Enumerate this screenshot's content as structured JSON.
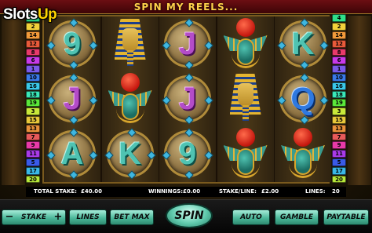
{
  "banner": {
    "text": "SPIN MY REELS..."
  },
  "watermark": {
    "brand": "Slots",
    "brand_accent": "Up"
  },
  "line_numbers": {
    "left": [
      "4",
      "2",
      "14",
      "12",
      "8",
      "6",
      "1",
      "10",
      "16",
      "18",
      "19",
      "3",
      "15",
      "13",
      "7",
      "9",
      "11",
      "5",
      "17",
      "20"
    ],
    "right": [
      "4",
      "2",
      "14",
      "12",
      "8",
      "6",
      "1",
      "10",
      "16",
      "18",
      "19",
      "3",
      "15",
      "13",
      "7",
      "9",
      "11",
      "5",
      "17",
      "20"
    ]
  },
  "line_colors": [
    "#2fe08a",
    "#f2d13a",
    "#f29a3a",
    "#e85a3a",
    "#e83a6a",
    "#c83ae8",
    "#7a5ae8",
    "#3a7ae8",
    "#3ac8e8",
    "#3ae8b8",
    "#5ae83a",
    "#c8e83a",
    "#e8c83a",
    "#e8903a",
    "#e85a5a",
    "#e83aa8",
    "#a83ae8",
    "#3a5ae8",
    "#3ab8e8",
    "#b8e83a"
  ],
  "reels": [
    {
      "symbols": [
        {
          "type": "tile",
          "glyph": "9",
          "color": "teal"
        },
        {
          "type": "tile",
          "glyph": "J",
          "color": "purple"
        },
        {
          "type": "tile",
          "glyph": "A",
          "color": "teal"
        }
      ]
    },
    {
      "symbols": [
        {
          "type": "pharaoh",
          "name": "pharaoh-mask"
        },
        {
          "type": "scarab",
          "name": "scarab"
        },
        {
          "type": "tile",
          "glyph": "K",
          "color": "teal"
        }
      ]
    },
    {
      "symbols": [
        {
          "type": "tile",
          "glyph": "J",
          "color": "purple"
        },
        {
          "type": "tile",
          "glyph": "J",
          "color": "purple"
        },
        {
          "type": "tile",
          "glyph": "9",
          "color": "teal"
        }
      ]
    },
    {
      "symbols": [
        {
          "type": "scarab",
          "name": "scarab"
        },
        {
          "type": "pharaoh",
          "name": "pharaoh-mask"
        },
        {
          "type": "scarab",
          "name": "scarab"
        }
      ]
    },
    {
      "symbols": [
        {
          "type": "tile",
          "glyph": "K",
          "color": "teal"
        },
        {
          "type": "tile",
          "glyph": "Q",
          "color": "blue"
        },
        {
          "type": "scarab",
          "name": "scarab"
        }
      ]
    }
  ],
  "info": {
    "total_stake_label": "TOTAL STAKE:",
    "total_stake_value": "£40.00",
    "winnings_label": "WINNINGS:",
    "winnings_value": "£0.00",
    "stake_line_label": "STAKE/LINE:",
    "stake_line_value": "£2.00",
    "lines_label": "LINES:",
    "lines_value": "20"
  },
  "controls": {
    "stake_minus": "−",
    "stake_label": "STAKE",
    "stake_plus": "+",
    "lines": "LINES",
    "bet_max": "BET MAX",
    "spin": "SPIN",
    "auto": "AUTO",
    "gamble": "GAMBLE",
    "paytable": "PAYTABLE"
  }
}
